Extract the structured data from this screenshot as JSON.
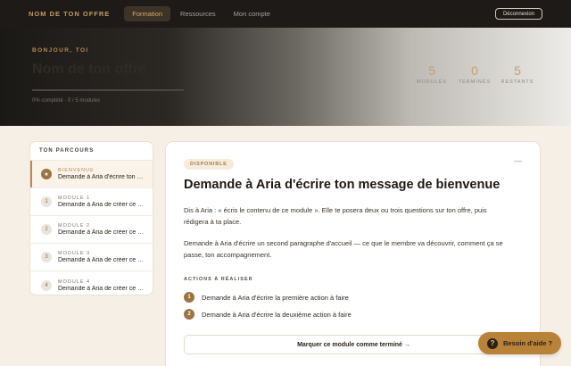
{
  "nav": {
    "brand": "NOM DE TON OFFRE",
    "items": [
      {
        "label": "Formation",
        "active": true
      },
      {
        "label": "Ressources",
        "active": false
      },
      {
        "label": "Mon compte",
        "active": false
      }
    ],
    "logout_label": "Déconnexion"
  },
  "hero": {
    "greeting": "BONJOUR, TOI",
    "title": "Nom de ton offre",
    "progress_percent": 0,
    "progress_text": "0% complété · 0 / 5 modules",
    "stats": [
      {
        "value": "5",
        "label": "MODULES"
      },
      {
        "value": "0",
        "label": "TERMINÉS"
      },
      {
        "value": "5",
        "label": "RESTANTS"
      }
    ]
  },
  "sidebar": {
    "heading": "TON PARCOURS",
    "items": [
      {
        "badge": "★",
        "kicker": "BIENVENUE",
        "title": "Demande à Aria d'écrire ton message de bienvenue",
        "active": true
      },
      {
        "badge": "1",
        "kicker": "MODULE 1",
        "title": "Demande à Aria de créer ce module",
        "active": false
      },
      {
        "badge": "2",
        "kicker": "MODULE 2",
        "title": "Demande à Aria de créer ce module",
        "active": false
      },
      {
        "badge": "3",
        "kicker": "MODULE 3",
        "title": "Demande à Aria de créer ce module",
        "active": false
      },
      {
        "badge": "4",
        "kicker": "MODULE 4",
        "title": "Demande à Aria de créer ce module",
        "active": false
      }
    ]
  },
  "main": {
    "status": "DISPONIBLE",
    "collapse_glyph": "—",
    "title": "Demande à Aria d'écrire ton message de bienvenue",
    "paragraph1": "Dis à Aria : « écris le contenu de ce module ». Elle te posera deux ou trois questions sur ton offre, puis rédigera à ta place.",
    "paragraph2": "Demande à Aria d'écrire un second paragraphe d'accueil — ce que le membre va découvrir, comment ça se passe, ton accompagnement.",
    "actions_heading": "ACTIONS À RÉALISER",
    "actions": [
      {
        "num": "1",
        "text": "Demande à Aria d'écrire la première action à faire"
      },
      {
        "num": "2",
        "text": "Demande à Aria d'écrire la deuxième action à faire"
      }
    ],
    "complete_button": "Marquer ce module comme terminé →"
  },
  "help": {
    "icon": "?",
    "label": "Besoin d'aide ?"
  },
  "colors": {
    "accent": "#b98a4f",
    "nav_bg": "#1d1a17",
    "page_bg": "#f6efe6",
    "help_bg": "#b88338"
  }
}
